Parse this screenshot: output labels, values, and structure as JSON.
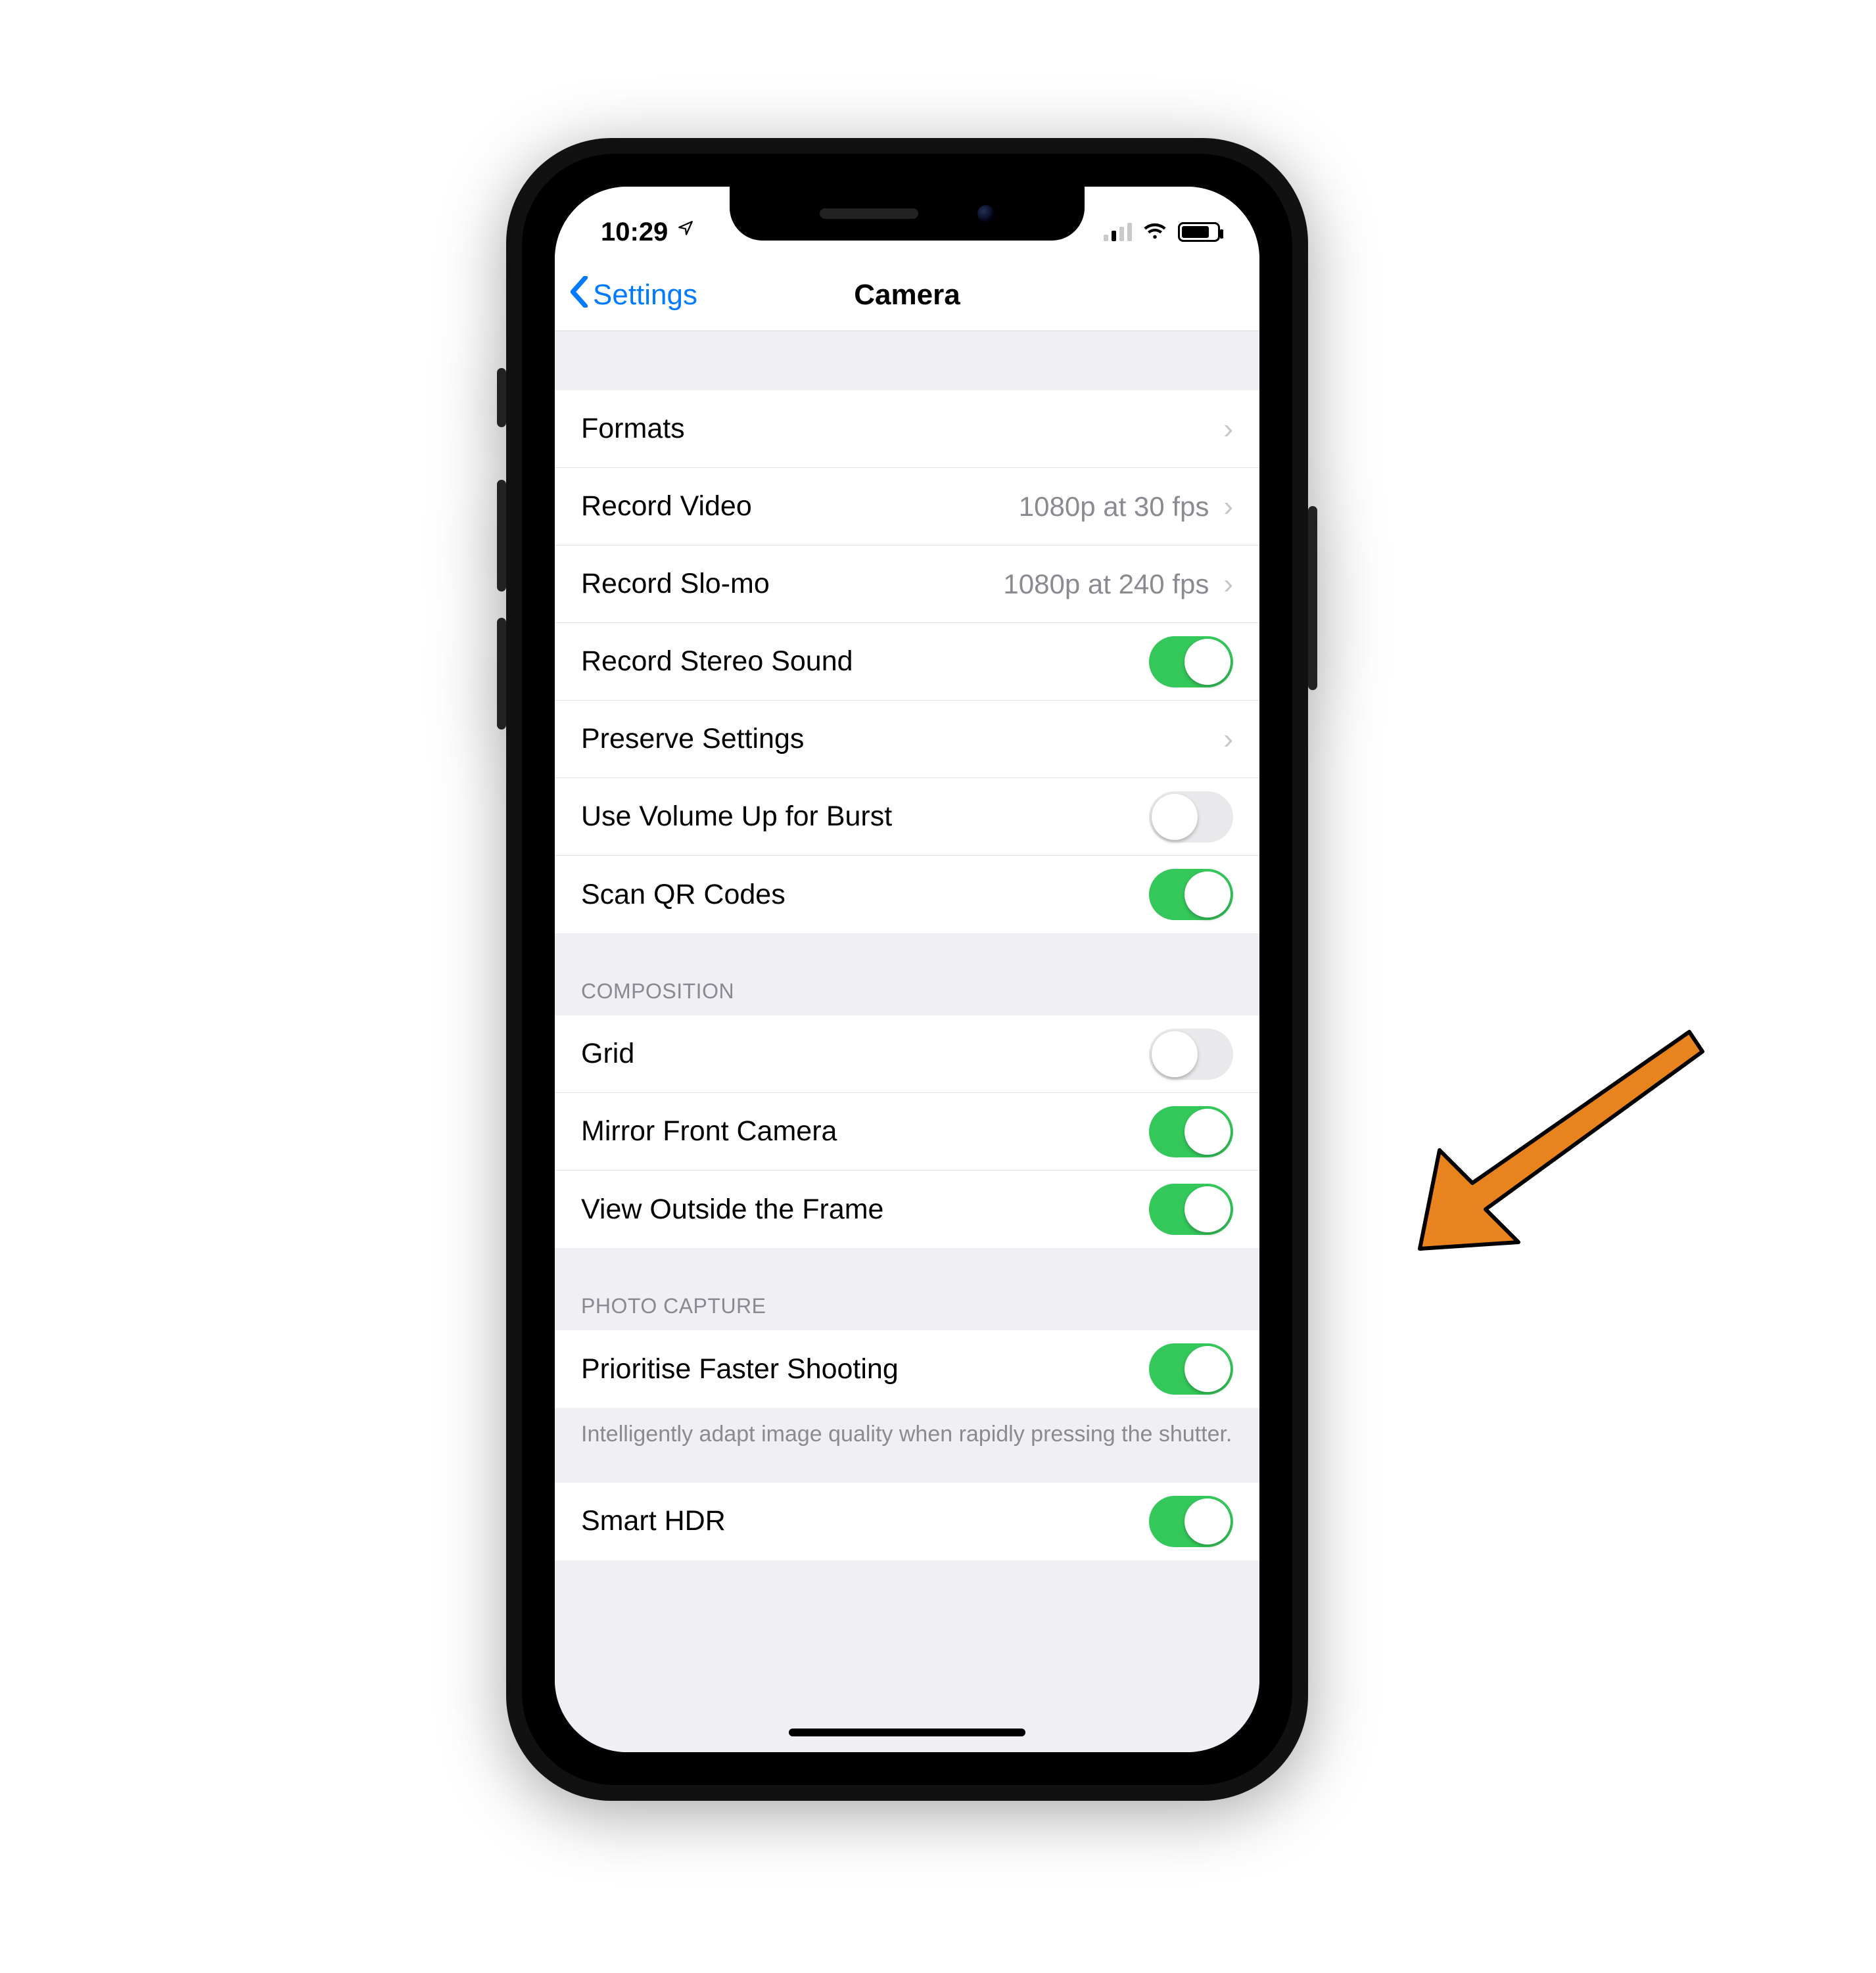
{
  "status": {
    "time": "10:29",
    "location_icon": "◤",
    "wifi_icon": "􀙇",
    "battery_pct": 70
  },
  "nav": {
    "back_label": "Settings",
    "title": "Camera"
  },
  "sections": {
    "main": {
      "formats": "Formats",
      "record_video": "Record Video",
      "record_video_detail": "1080p at 30 fps",
      "record_slomo": "Record Slo-mo",
      "record_slomo_detail": "1080p at 240 fps",
      "stereo": "Record Stereo Sound",
      "stereo_on": true,
      "preserve": "Preserve Settings",
      "vol_burst": "Use Volume Up for Burst",
      "vol_burst_on": false,
      "qr": "Scan QR Codes",
      "qr_on": true
    },
    "composition": {
      "header": "COMPOSITION",
      "grid": "Grid",
      "grid_on": false,
      "mirror": "Mirror Front Camera",
      "mirror_on": true,
      "outside": "View Outside the Frame",
      "outside_on": true
    },
    "photo_capture": {
      "header": "PHOTO CAPTURE",
      "prioritise": "Prioritise Faster Shooting",
      "prioritise_on": true,
      "footer": "Intelligently adapt image quality when rapidly pressing the shutter.",
      "smart_hdr": "Smart HDR",
      "smart_hdr_on": true
    }
  },
  "annotation": {
    "arrow_color": "#e8831e"
  }
}
